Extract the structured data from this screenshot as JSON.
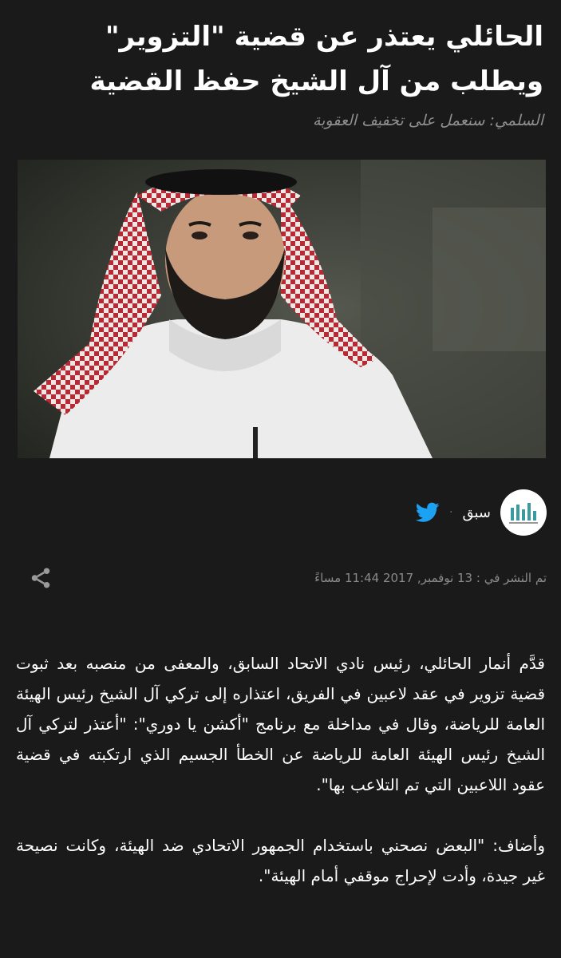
{
  "article": {
    "title": "الحائلي يعتذر عن قضية \"التزوير\" ويطلب من آل الشيخ حفظ القضية",
    "subtitle": "السلمي: سنعمل على تخفيف العقوبة",
    "source": {
      "name": "سبق",
      "separator": "·",
      "logo_icon": "sabq-logo",
      "social_icon": "twitter-icon"
    },
    "publish_date": "تم النشر في : 13 نوفمبر, 2017 11:44 مساءً",
    "share_icon": "share-icon",
    "paragraphs": [
      "قدَّم أنمار الحائلي، رئيس نادي الاتحاد السابق، والمعفى من منصبه بعد ثبوت قضية تزوير في عقد لاعبين في الفريق، اعتذاره إلى تركي آل الشيخ رئيس الهيئة العامة للرياضة، وقال في مداخلة مع برنامج \"أكشن يا دوري\": \"أعتذر لتركي آل الشيخ رئيس الهيئة العامة للرياضة عن الخطأ الجسيم الذي ارتكبته في قضية عقود اللاعبين التي تم التلاعب بها\".",
      "وأضاف: \"البعض نصحني باستخدام الجمهور الاتحادي ضد الهيئة، وكانت نصيحة غير جيدة، وأدت لإحراج موقفي أمام الهيئة\"."
    ]
  },
  "colors": {
    "background": "#1a1a1a",
    "text": "#ffffff",
    "muted": "#8a8a8a",
    "twitter": "#1da1f2"
  }
}
